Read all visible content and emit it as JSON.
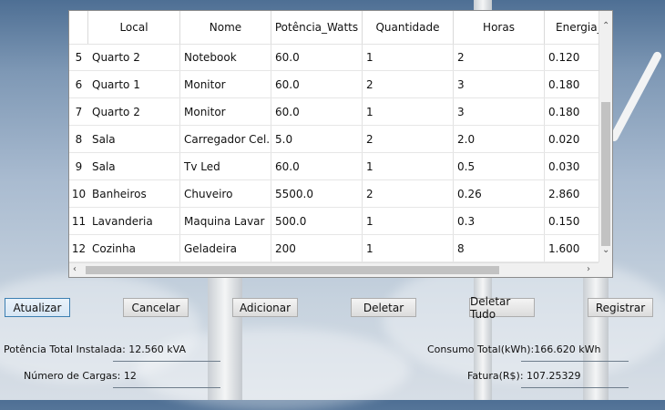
{
  "table": {
    "columns": [
      "Local",
      "Nome",
      "Potência_Watts",
      "Quantidade",
      "Horas",
      "Energia_"
    ],
    "rows": [
      {
        "num": "5",
        "cells": [
          "Quarto 2",
          "Notebook",
          "60.0",
          "1",
          "2",
          "0.120"
        ]
      },
      {
        "num": "6",
        "cells": [
          "Quarto 1",
          "Monitor",
          "60.0",
          "2",
          "3",
          "0.180"
        ]
      },
      {
        "num": "7",
        "cells": [
          "Quarto 2",
          "Monitor",
          "60.0",
          "1",
          "3",
          "0.180"
        ]
      },
      {
        "num": "8",
        "cells": [
          "Sala",
          "Carregador Cel...",
          "5.0",
          "2",
          "2.0",
          "0.020"
        ]
      },
      {
        "num": "9",
        "cells": [
          "Sala",
          "Tv Led",
          "60.0",
          "1",
          "0.5",
          "0.030"
        ]
      },
      {
        "num": "10",
        "cells": [
          "Banheiros",
          "Chuveiro",
          "5500.0",
          "2",
          "0.26",
          "2.860"
        ]
      },
      {
        "num": "11",
        "cells": [
          "Lavanderia",
          "Maquina Lavar",
          "500.0",
          "1",
          "0.3",
          "0.150"
        ]
      },
      {
        "num": "12",
        "cells": [
          "Cozinha",
          "Geladeira",
          "200",
          "1",
          "8",
          "1.600"
        ]
      }
    ]
  },
  "buttons": {
    "atualizar": "Atualizar",
    "cancelar": "Cancelar",
    "adicionar": "Adicionar",
    "deletar": "Deletar",
    "deletar_tudo": "Deletar Tudo",
    "registrar": "Registrar"
  },
  "summary": {
    "potencia": "Potência Total Instalada: 12.560 kVA",
    "numero_cargas": "Número de Cargas: 12",
    "consumo": "Consumo Total(kWh):166.620 kWh",
    "fatura": "Fatura(R$): 107.25329"
  },
  "icons": {
    "scroll_up": "scroll-up-arrow",
    "scroll_left": "scroll-left-arrow",
    "scroll_right": "scroll-right-arrow"
  }
}
